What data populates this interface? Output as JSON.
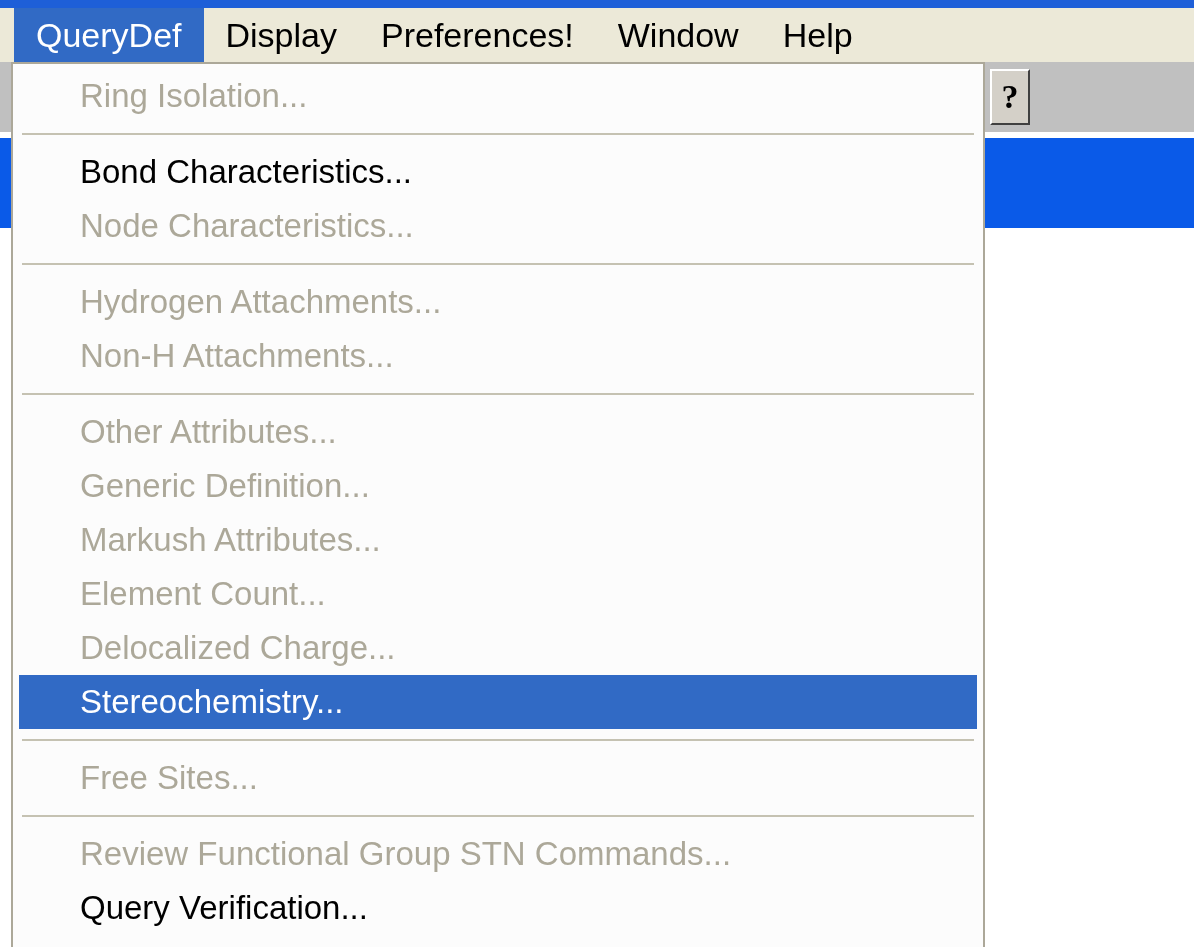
{
  "menubar": [
    {
      "label": "QueryDef",
      "selected": true
    },
    {
      "label": "Display",
      "selected": false
    },
    {
      "label": "Preferences!",
      "selected": false
    },
    {
      "label": "Window",
      "selected": false
    },
    {
      "label": "Help",
      "selected": false
    }
  ],
  "toolbar": {
    "help_button": "?"
  },
  "menu": [
    {
      "kind": "item",
      "label": "Ring Isolation...",
      "enabled": false,
      "selected": false
    },
    {
      "kind": "separator"
    },
    {
      "kind": "item",
      "label": "Bond Characteristics...",
      "enabled": true,
      "selected": false
    },
    {
      "kind": "item",
      "label": "Node Characteristics...",
      "enabled": false,
      "selected": false
    },
    {
      "kind": "separator"
    },
    {
      "kind": "item",
      "label": "Hydrogen Attachments...",
      "enabled": false,
      "selected": false
    },
    {
      "kind": "item",
      "label": "Non-H Attachments...",
      "enabled": false,
      "selected": false
    },
    {
      "kind": "separator"
    },
    {
      "kind": "item",
      "label": "Other Attributes...",
      "enabled": false,
      "selected": false
    },
    {
      "kind": "item",
      "label": "Generic Definition...",
      "enabled": false,
      "selected": false
    },
    {
      "kind": "item",
      "label": "Markush Attributes...",
      "enabled": false,
      "selected": false
    },
    {
      "kind": "item",
      "label": "Element Count...",
      "enabled": false,
      "selected": false
    },
    {
      "kind": "item",
      "label": "Delocalized Charge...",
      "enabled": false,
      "selected": false
    },
    {
      "kind": "item",
      "label": "Stereochemistry...",
      "enabled": true,
      "selected": true
    },
    {
      "kind": "separator"
    },
    {
      "kind": "item",
      "label": "Free Sites...",
      "enabled": false,
      "selected": false
    },
    {
      "kind": "separator"
    },
    {
      "kind": "item",
      "label": "Review Functional Group STN Commands...",
      "enabled": false,
      "selected": false
    },
    {
      "kind": "item",
      "label": "Query Verification...",
      "enabled": true,
      "selected": false
    }
  ]
}
